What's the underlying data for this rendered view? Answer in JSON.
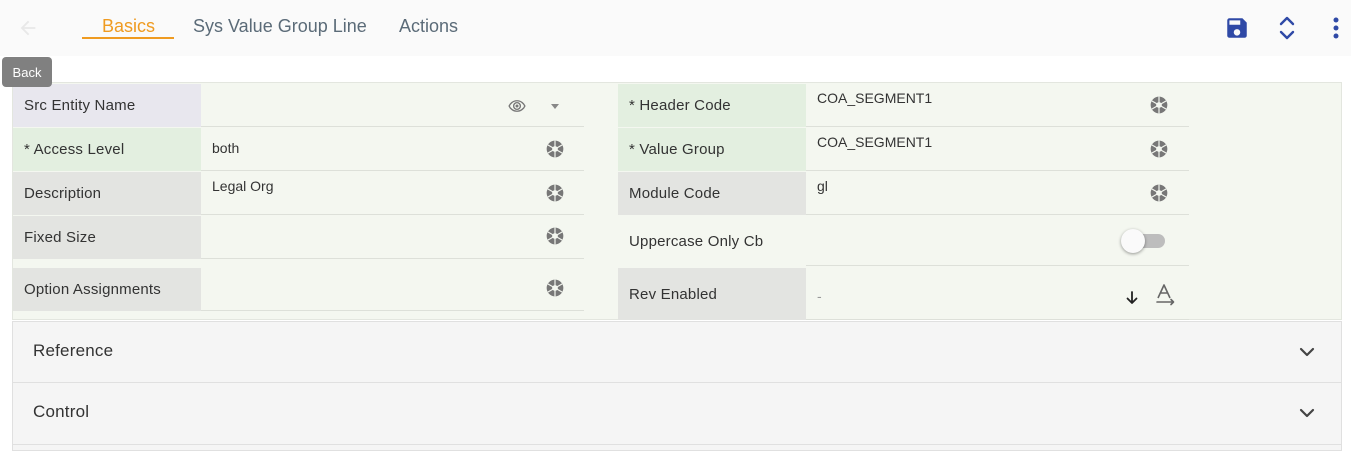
{
  "header": {
    "tabs": [
      {
        "label": "Basics",
        "active": true
      },
      {
        "label": "Sys Value Group Line",
        "active": false
      },
      {
        "label": "Actions",
        "active": false
      }
    ],
    "back_tooltip": "Back",
    "icons": {
      "back": "arrow-left-icon",
      "save": "save-icon",
      "expand": "unfold-icon",
      "more": "more-vertical-icon"
    },
    "colors": {
      "accent": "#ef9b21",
      "save": "#2f49a6"
    }
  },
  "form": {
    "left": [
      {
        "label": "Src Entity Name",
        "value": ""
      },
      {
        "label": "* Access Level",
        "value": "both"
      },
      {
        "label": "Description",
        "value": "Legal Org"
      },
      {
        "label": "Fixed Size",
        "value": ""
      },
      {
        "label": "Option Assignments",
        "value": ""
      }
    ],
    "right": [
      {
        "label": "* Header Code",
        "value": "COA_SEGMENT1"
      },
      {
        "label": "* Value Group",
        "value": "COA_SEGMENT1"
      },
      {
        "label": "Module Code",
        "value": "gl"
      },
      {
        "label": "Uppercase Only Cb",
        "value": ""
      },
      {
        "label": "Rev Enabled",
        "value": "-"
      }
    ],
    "uppercase_only_cb": false
  },
  "sections": [
    {
      "title": "Reference"
    },
    {
      "title": "Control"
    }
  ]
}
